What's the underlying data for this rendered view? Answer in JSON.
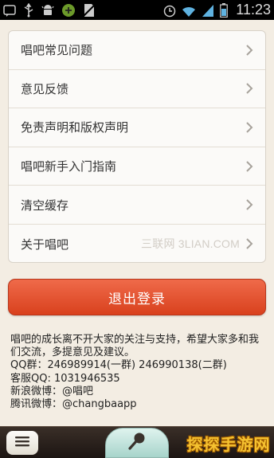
{
  "status_bar": {
    "time": "11:23"
  },
  "menu": {
    "items": [
      {
        "label": "唱吧常见问题"
      },
      {
        "label": "意见反馈"
      },
      {
        "label": "免责声明和版权声明"
      },
      {
        "label": "唱吧新手入门指南"
      },
      {
        "label": "清空缓存"
      },
      {
        "label": "关于唱吧"
      }
    ],
    "watermark": "三联网 3LIAN.COM"
  },
  "logout_label": "退出登录",
  "info": {
    "line1": "唱吧的成长离不开大家的关注与支持，希望大家多和我们交流，多提意见及建议。",
    "qq_group": "QQ群：246989914(一群) 246990138(二群)",
    "service_qq": "客服QQ: 1031946535",
    "weibo_sina": "新浪微博：@唱吧",
    "weibo_tencent": "腾讯微博：@changbaapp"
  },
  "corner_logo": "探探手游网",
  "icons": {
    "status_left": [
      "notification-icon",
      "usb-icon",
      "android-debug-icon",
      "gps-icon",
      "no-sim-icon"
    ],
    "status_right": [
      "alarm-icon",
      "wifi-icon",
      "signal-icon",
      "battery-icon"
    ]
  }
}
